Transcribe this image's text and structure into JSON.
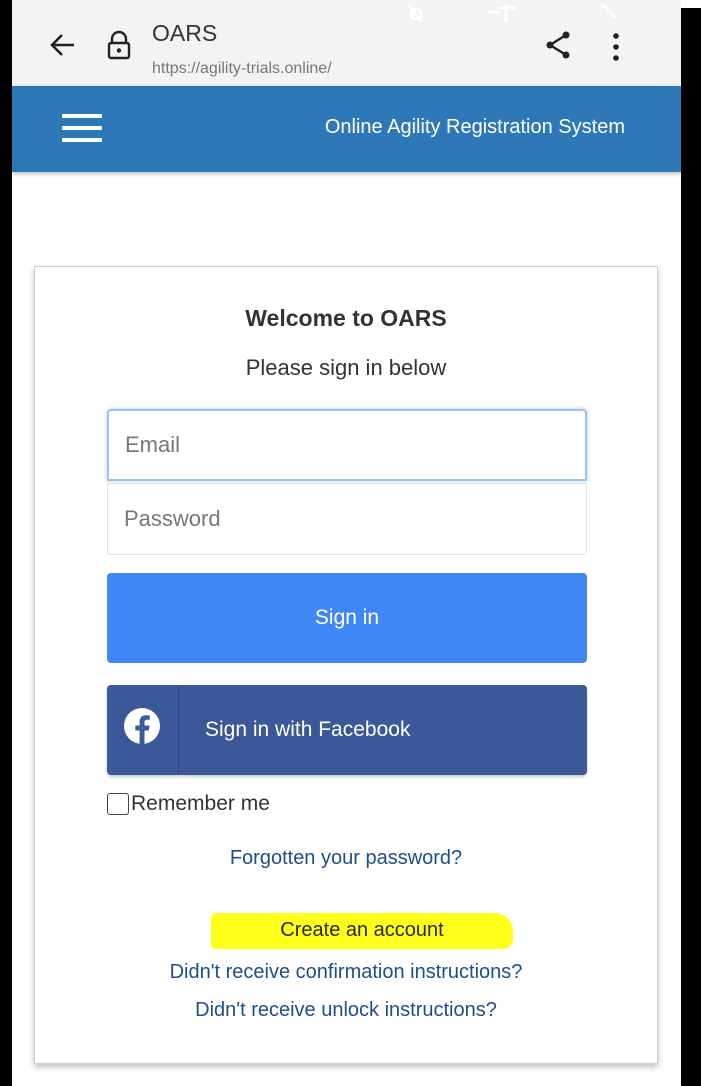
{
  "browser": {
    "site_title": "OARS",
    "url": "https://agility-trials.online/"
  },
  "header": {
    "app_title": "Online Agility Registration System"
  },
  "login": {
    "welcome": "Welcome to OARS",
    "subtitle": "Please sign in below",
    "email_placeholder": "Email",
    "password_placeholder": "Password",
    "signin_label": "Sign in",
    "facebook_label": "Sign in with Facebook",
    "remember_label": "Remember me",
    "remember_checked": false,
    "forgot_link": "Forgotten your password?",
    "create_link": "Create an account",
    "confirm_link": "Didn't receive confirmation instructions?",
    "unlock_link": "Didn't receive unlock instructions?"
  },
  "colors": {
    "header_blue": "#2f78b7",
    "signin_blue": "#3f87f5",
    "facebook_blue": "#3b5998",
    "link_blue": "#1f4e8c",
    "highlight_yellow": "#ffff1a"
  },
  "icons": [
    "back-arrow-icon",
    "lock-icon",
    "share-icon",
    "more-vert-icon",
    "hamburger-menu-icon",
    "facebook-icon"
  ]
}
